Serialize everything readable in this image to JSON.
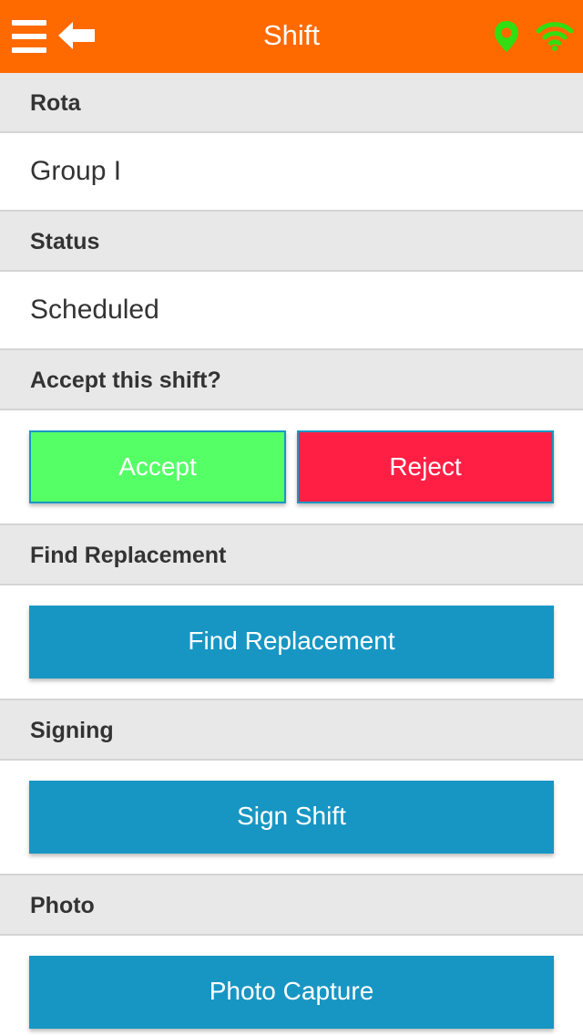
{
  "header": {
    "title": "Shift",
    "menu_icon": "menu-icon",
    "back_icon": "back-arrow-icon",
    "location_icon": "location-pin-icon",
    "wifi_icon": "wifi-icon",
    "bar_color": "#ff6a00",
    "status_icon_color": "#33dd11"
  },
  "rota": {
    "label": "Rota",
    "value": "Group I"
  },
  "status": {
    "label": "Status",
    "value": "Scheduled"
  },
  "accept": {
    "label": "Accept this shift?",
    "accept_button": "Accept",
    "reject_button": "Reject",
    "accept_color": "#55ff66",
    "reject_color": "#ff1f44"
  },
  "replacement": {
    "label": "Find Replacement",
    "button": "Find Replacement"
  },
  "signing": {
    "label": "Signing",
    "button": "Sign Shift"
  },
  "photo": {
    "label": "Photo",
    "button": "Photo Capture"
  },
  "colors": {
    "primary_button": "#1896c3",
    "section_header_bg": "#e8e8e8"
  }
}
